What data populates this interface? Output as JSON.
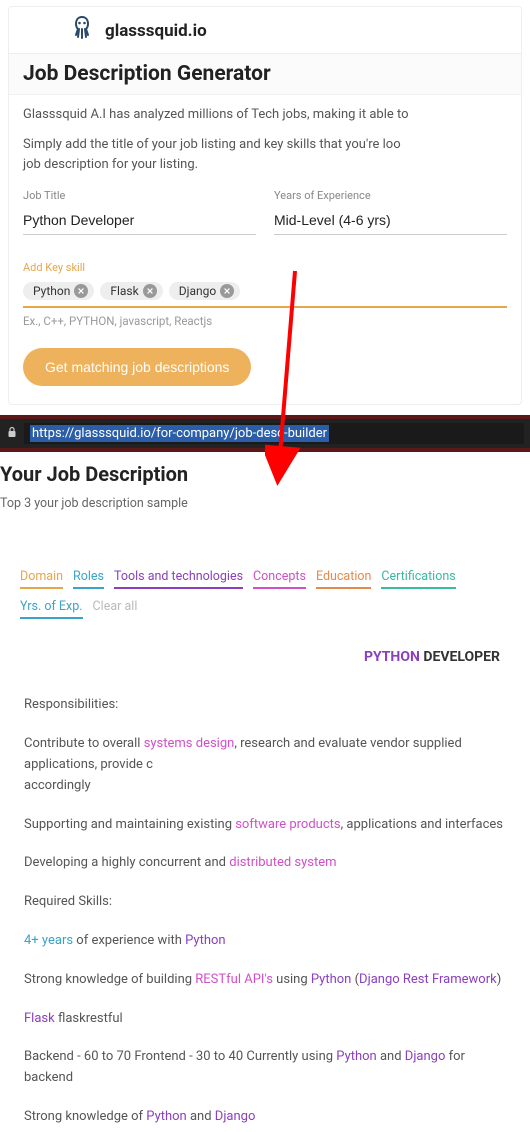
{
  "brand": {
    "name": "glasssquid.io"
  },
  "generator": {
    "heading": "Job Description Generator",
    "desc1": "Glasssquid A.I has analyzed millions of Tech jobs, making it able to",
    "desc2": "Simply add the title of your job listing and key skills that you're loo",
    "desc3": "job description for your listing.",
    "fields": {
      "title_label": "Job Title",
      "title_value": "Python Developer",
      "exp_label": "Years of Experience",
      "exp_value": "Mid-Level (4-6 yrs)"
    },
    "skills": {
      "label": "Add Key skill",
      "chips": [
        "Python",
        "Flask",
        "Django"
      ],
      "hint": "Ex., C++, PYTHON, javascript, Reactjs"
    },
    "cta": "Get matching job descriptions"
  },
  "urlbar": {
    "url": "https://glasssquid.io/for-company/job-desc-builder"
  },
  "results": {
    "heading": "Your Job Description",
    "sub": "Top 3 your job description sample",
    "filters": {
      "domain": "Domain",
      "roles": "Roles",
      "tools": "Tools and technologies",
      "concepts": "Concepts",
      "education": "Education",
      "cert": "Certifications",
      "yrs": "Yrs. of Exp.",
      "clear": "Clear all"
    },
    "jd_title_hl": "PYTHON",
    "jd_title_rest": " DEVELOPER",
    "body": {
      "resp_h": "Responsibilities:",
      "l1a": "Contribute to overall ",
      "l1b": "systems design",
      "l1c": ", research and evaluate vendor supplied applications, provide c",
      "l1d": "accordingly",
      "l2a": "Supporting and maintaining existing ",
      "l2b": "software products",
      "l2c": ", applications and interfaces",
      "l3a": "Developing a highly concurrent and ",
      "l3b": "distributed system",
      "req_h": "Required Skills:",
      "l4a": "4+ years",
      "l4b": " of experience with ",
      "l4c": "Python",
      "l5a": "Strong knowledge of building ",
      "l5b": "RESTful API's",
      "l5c": " using ",
      "l5d": "Python",
      "l5e": " (",
      "l5f": "Django Rest Framework",
      "l5g": ")",
      "l6a": "Flask",
      "l6b": " flaskrestful",
      "l7a": "Backend - 60 to 70 Frontend - 30 to 40 Currently using ",
      "l7b": "Python",
      "l7c": " and ",
      "l7d": "Django",
      "l7e": " for backend",
      "l8a": "Strong knowledge of ",
      "l8b": "Python",
      "l8c": " and ",
      "l8d": "Django"
    }
  }
}
